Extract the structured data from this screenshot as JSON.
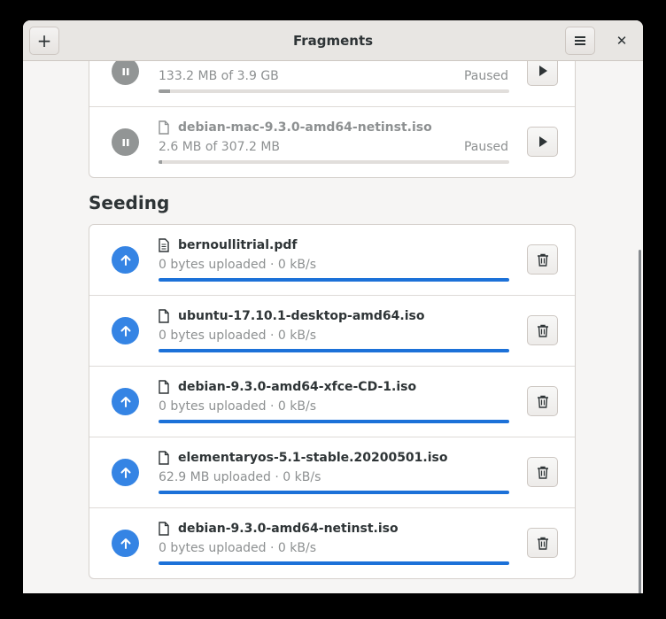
{
  "window": {
    "title": "Fragments"
  },
  "colors": {
    "accent": "#3584e4",
    "progress": "#1c71d8",
    "paused": "#929595"
  },
  "icons": {
    "add": "plus-icon",
    "menu": "hamburger-menu-icon",
    "close": "close-icon",
    "pause": "pause-icon",
    "play": "play-icon",
    "upload": "arrow-up-icon",
    "delete": "trash-icon",
    "file": "file-icon"
  },
  "paused": {
    "items": [
      {
        "name": "",
        "progress_text": "133.2 MB of 3.9 GB",
        "status": "Paused",
        "progress": 0.034
      },
      {
        "name": "debian-mac-9.3.0-amd64-netinst.iso",
        "progress_text": "2.6 MB of 307.2 MB",
        "status": "Paused",
        "progress": 0.009
      }
    ]
  },
  "seeding": {
    "title": "Seeding",
    "items": [
      {
        "name": "bernoullitrial.pdf",
        "progress_text": "0 bytes uploaded · 0 kB/s",
        "progress": 1.0
      },
      {
        "name": "ubuntu-17.10.1-desktop-amd64.iso",
        "progress_text": "0 bytes uploaded · 0 kB/s",
        "progress": 1.0
      },
      {
        "name": "debian-9.3.0-amd64-xfce-CD-1.iso",
        "progress_text": "0 bytes uploaded · 0 kB/s",
        "progress": 1.0
      },
      {
        "name": "elementaryos-5.1-stable.20200501.iso",
        "progress_text": "62.9 MB uploaded · 0 kB/s",
        "progress": 1.0
      },
      {
        "name": "debian-9.3.0-amd64-netinst.iso",
        "progress_text": "0 bytes uploaded · 0 kB/s",
        "progress": 1.0
      }
    ]
  }
}
